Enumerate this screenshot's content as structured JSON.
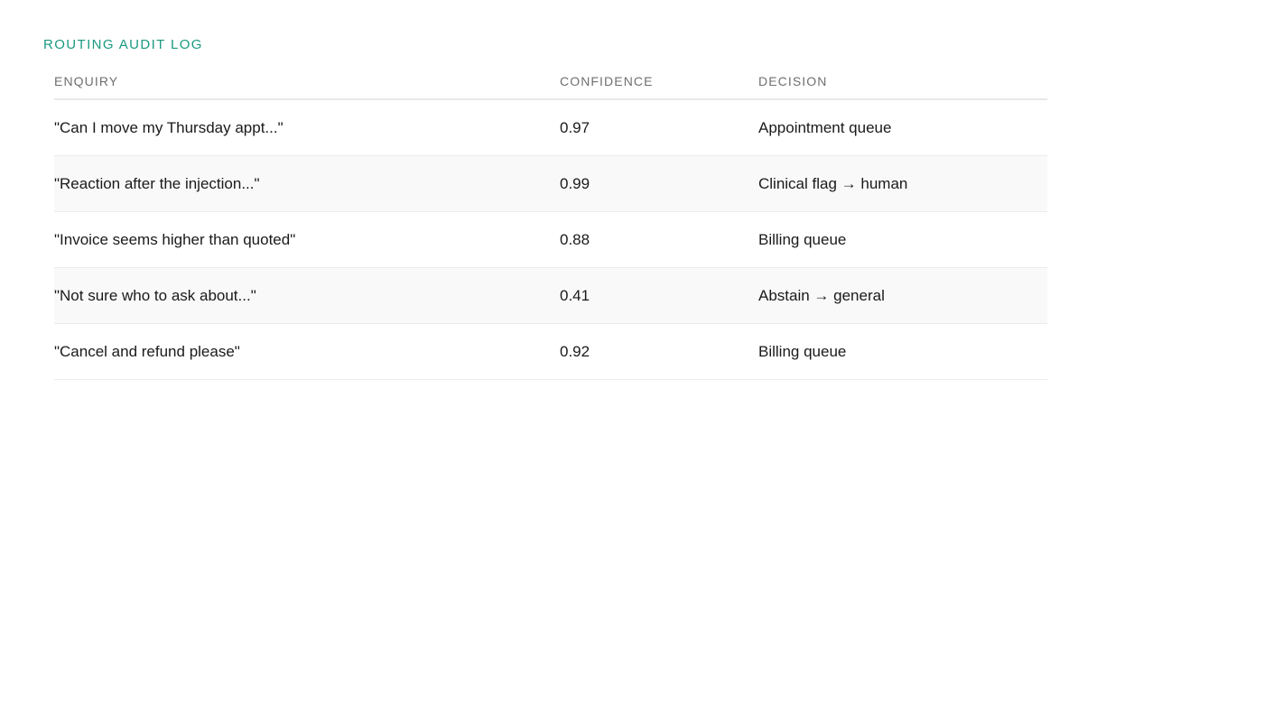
{
  "log": {
    "title": "ROUTING AUDIT LOG",
    "columns": {
      "enquiry": "ENQUIRY",
      "confidence": "CONFIDENCE",
      "decision": "DECISION"
    },
    "rows": [
      {
        "enquiry": "\"Can I move my Thursday appt...\"",
        "confidence": "0.97",
        "decision": "Appointment queue"
      },
      {
        "enquiry": "\"Reaction after the injection...\"",
        "confidence": "0.99",
        "decision": "Clinical flag → human"
      },
      {
        "enquiry": "\"Invoice seems higher than quoted\"",
        "confidence": "0.88",
        "decision": "Billing queue"
      },
      {
        "enquiry": "\"Not sure who to ask about...\"",
        "confidence": "0.41",
        "decision": "Abstain → general"
      },
      {
        "enquiry": "\"Cancel and refund please\"",
        "confidence": "0.92",
        "decision": "Billing queue"
      }
    ]
  }
}
